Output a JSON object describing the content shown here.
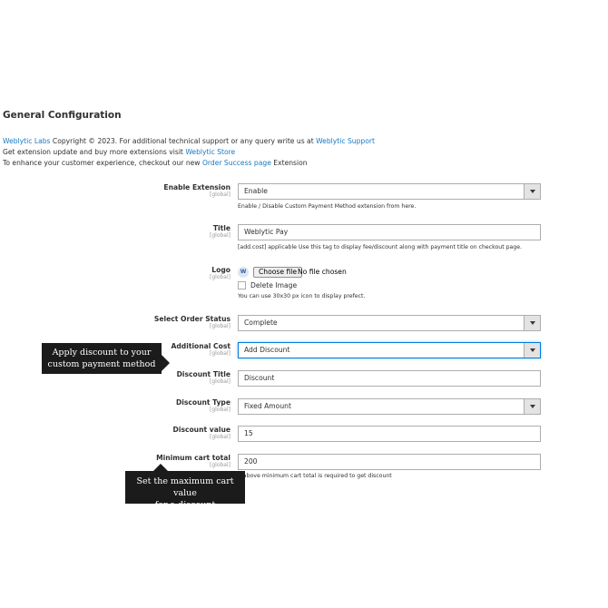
{
  "section": {
    "title": "General Configuration"
  },
  "intro": {
    "line1_link1": "Weblytic Labs",
    "line1_text": " Copyright © 2023. For additional technical support or any query write us at ",
    "line1_link2": "Weblytic Support",
    "line2_text": "Get extension update and buy more extensions visit ",
    "line2_link": "Weblytic Store",
    "line3_text": "To enhance your customer experience, checkout our new ",
    "line3_link": "Order Success page",
    "line3_suffix": " Extension"
  },
  "fields": {
    "enable_extension": {
      "label": "Enable Extension",
      "scope": "[global]",
      "value": "Enable",
      "note": "Enable / Disable Custom Payment Method extension from here."
    },
    "title": {
      "label": "Title",
      "scope": "[global]",
      "value": "Weblytic Pay",
      "note": "[add.cost] applicable Use this tag to display fee/discount along with payment title on checkout page."
    },
    "logo": {
      "label": "Logo",
      "scope": "[global]",
      "icon_text": "W",
      "button": "Choose file",
      "status": "No file chosen",
      "delete_label": "Delete Image",
      "note": "You can use 30x30 px icon to display prefect."
    },
    "order_status": {
      "label": "Select Order Status",
      "scope": "[global]",
      "value": "Complete"
    },
    "additional_cost": {
      "label": "Additional Cost",
      "scope": "[global]",
      "value": "Add Discount"
    },
    "discount_title": {
      "label": "Discount Title",
      "scope": "[global]",
      "value": "Discount"
    },
    "discount_type": {
      "label": "Discount Type",
      "scope": "[global]",
      "value": "Fixed Amount"
    },
    "discount_value": {
      "label": "Discount value",
      "scope": "[global]",
      "value": "15"
    },
    "min_cart_total": {
      "label": "Minimum cart total",
      "scope": "[global]",
      "value": "200",
      "note": "e above minimum cart total is required to get discount"
    }
  },
  "tooltips": {
    "discount": {
      "line1": "Apply discount to your",
      "line2": "custom payment method"
    },
    "max_cart": {
      "line1": "Set the maximum cart value",
      "line2": "for a discount"
    }
  },
  "colors": {
    "link": "#1979c3",
    "tooltip_bg": "#1b1b1b",
    "focus_border": "#007bdb"
  }
}
